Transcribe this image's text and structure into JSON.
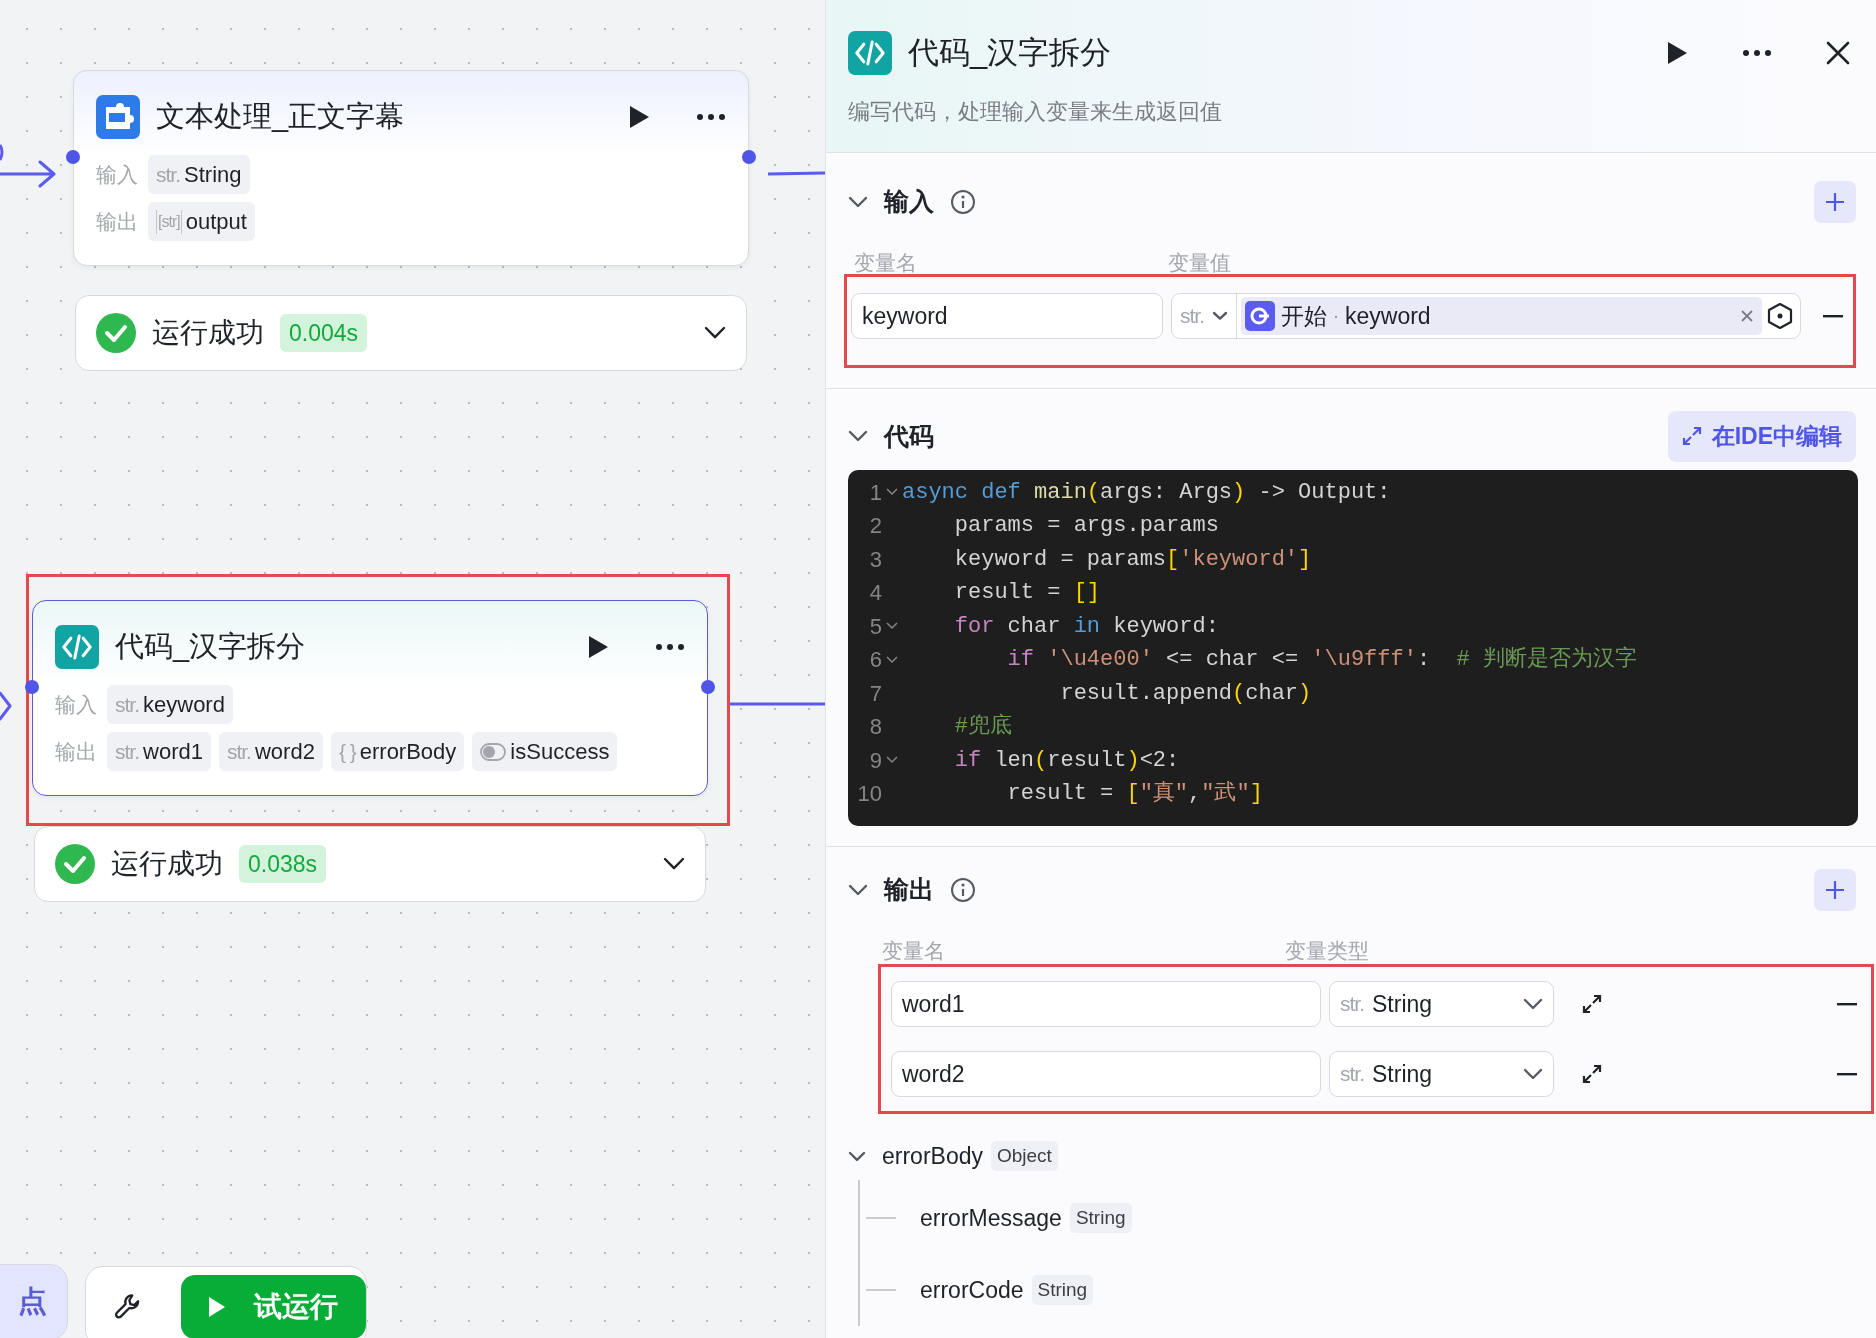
{
  "canvas": {
    "nodes": [
      {
        "kind": "text",
        "title": "文本处理_正文字幕",
        "selected": false,
        "highlighted": false,
        "inputs_label": "输入",
        "inputs": [
          {
            "kind": "str",
            "type_label": "str.",
            "name": "String"
          }
        ],
        "outputs_label": "输出",
        "outputs": [
          {
            "kind": "list",
            "type_label": "[str]",
            "name": "output"
          }
        ],
        "status": {
          "text": "运行成功",
          "time": "0.004s"
        }
      },
      {
        "kind": "code",
        "title": "代码_汉字拆分",
        "selected": true,
        "highlighted": true,
        "inputs_label": "输入",
        "inputs": [
          {
            "kind": "str",
            "type_label": "str.",
            "name": "keyword"
          }
        ],
        "outputs_label": "输出",
        "outputs": [
          {
            "kind": "str",
            "type_label": "str.",
            "name": "word1"
          },
          {
            "kind": "str",
            "type_label": "str.",
            "name": "word2"
          },
          {
            "kind": "object",
            "type_label": "{ }",
            "name": "errorBody"
          },
          {
            "kind": "bool",
            "name": "isSuccess"
          }
        ],
        "status": {
          "text": "运行成功",
          "time": "0.038s"
        }
      }
    ],
    "toolbar": {
      "partial_button": "点",
      "run_button": "试运行"
    }
  },
  "panel": {
    "kind": "code",
    "title": "代码_汉字拆分",
    "description": "编写代码，处理输入变量来生成返回值",
    "input": {
      "title": "输入",
      "expanded": true,
      "highlighted": true,
      "headers": [
        "变量名",
        "变量值"
      ],
      "rows": [
        {
          "name": "keyword",
          "type_label": "str.",
          "ref_node": "开始",
          "separator": "·",
          "ref_var": "keyword"
        }
      ]
    },
    "code": {
      "title": "代码",
      "expanded": true,
      "ide_button": "在IDE中编辑",
      "lines": [
        {
          "n": "1",
          "foldable": true,
          "tokens": [
            {
              "kind": "kw",
              "t": "async"
            },
            {
              "kind": "kw",
              "t": " def"
            },
            {
              "kind": "fn",
              "t": " main"
            },
            {
              "kind": "br",
              "t": "("
            },
            {
              "kind": "p",
              "t": "args: Args"
            },
            {
              "kind": "br",
              "t": ")"
            },
            {
              "kind": "p",
              "t": " -> Output:"
            }
          ]
        },
        {
          "n": "2",
          "foldable": false,
          "tokens": [
            {
              "kind": "p",
              "t": "    params = args.params"
            }
          ]
        },
        {
          "n": "3",
          "foldable": false,
          "tokens": [
            {
              "kind": "p",
              "t": "    keyword = params"
            },
            {
              "kind": "br",
              "t": "["
            },
            {
              "kind": "str",
              "t": "'keyword'"
            },
            {
              "kind": "br",
              "t": "]"
            }
          ]
        },
        {
          "n": "4",
          "foldable": false,
          "tokens": [
            {
              "kind": "p",
              "t": "    result = "
            },
            {
              "kind": "br",
              "t": "[]"
            }
          ]
        },
        {
          "n": "5",
          "foldable": true,
          "tokens": [
            {
              "kind": "ctl",
              "t": "    for"
            },
            {
              "kind": "p",
              "t": " char "
            },
            {
              "kind": "kw",
              "t": "in"
            },
            {
              "kind": "p",
              "t": " keyword:"
            }
          ]
        },
        {
          "n": "6",
          "foldable": true,
          "tokens": [
            {
              "kind": "ctl",
              "t": "        if"
            },
            {
              "kind": "str",
              "t": " '\\u4e00'"
            },
            {
              "kind": "p",
              "t": " <= char <= "
            },
            {
              "kind": "str",
              "t": "'\\u9fff'"
            },
            {
              "kind": "p",
              "t": ":  "
            },
            {
              "kind": "cm",
              "t": "# 判断是否为汉字"
            }
          ]
        },
        {
          "n": "7",
          "foldable": false,
          "tokens": [
            {
              "kind": "p",
              "t": "            result.append"
            },
            {
              "kind": "br",
              "t": "("
            },
            {
              "kind": "p",
              "t": "char"
            },
            {
              "kind": "br",
              "t": ")"
            }
          ]
        },
        {
          "n": "8",
          "foldable": false,
          "tokens": [
            {
              "kind": "cm",
              "t": "    #兜底"
            }
          ]
        },
        {
          "n": "9",
          "foldable": true,
          "tokens": [
            {
              "kind": "ctl",
              "t": "    if"
            },
            {
              "kind": "p",
              "t": " len"
            },
            {
              "kind": "br",
              "t": "("
            },
            {
              "kind": "p",
              "t": "result"
            },
            {
              "kind": "br",
              "t": ")"
            },
            {
              "kind": "p",
              "t": "<2:"
            }
          ]
        },
        {
          "n": "10",
          "foldable": false,
          "tokens": [
            {
              "kind": "p",
              "t": "        result = "
            },
            {
              "kind": "br",
              "t": "["
            },
            {
              "kind": "str",
              "t": "\"真\""
            },
            {
              "kind": "p",
              "t": ","
            },
            {
              "kind": "str",
              "t": "\"武\""
            },
            {
              "kind": "br",
              "t": "]"
            }
          ]
        }
      ]
    },
    "output": {
      "title": "输出",
      "expanded": true,
      "highlighted": true,
      "headers": [
        "变量名",
        "变量类型"
      ],
      "rows": [
        {
          "name": "word1",
          "type_label": "str.",
          "type": "String"
        },
        {
          "name": "word2",
          "type_label": "str.",
          "type": "String"
        }
      ],
      "tree": [
        {
          "name": "errorBody",
          "type": "Object",
          "expanded": true,
          "children": [
            {
              "name": "errorMessage",
              "type": "String"
            },
            {
              "name": "errorCode",
              "type": "String"
            }
          ]
        }
      ]
    }
  }
}
